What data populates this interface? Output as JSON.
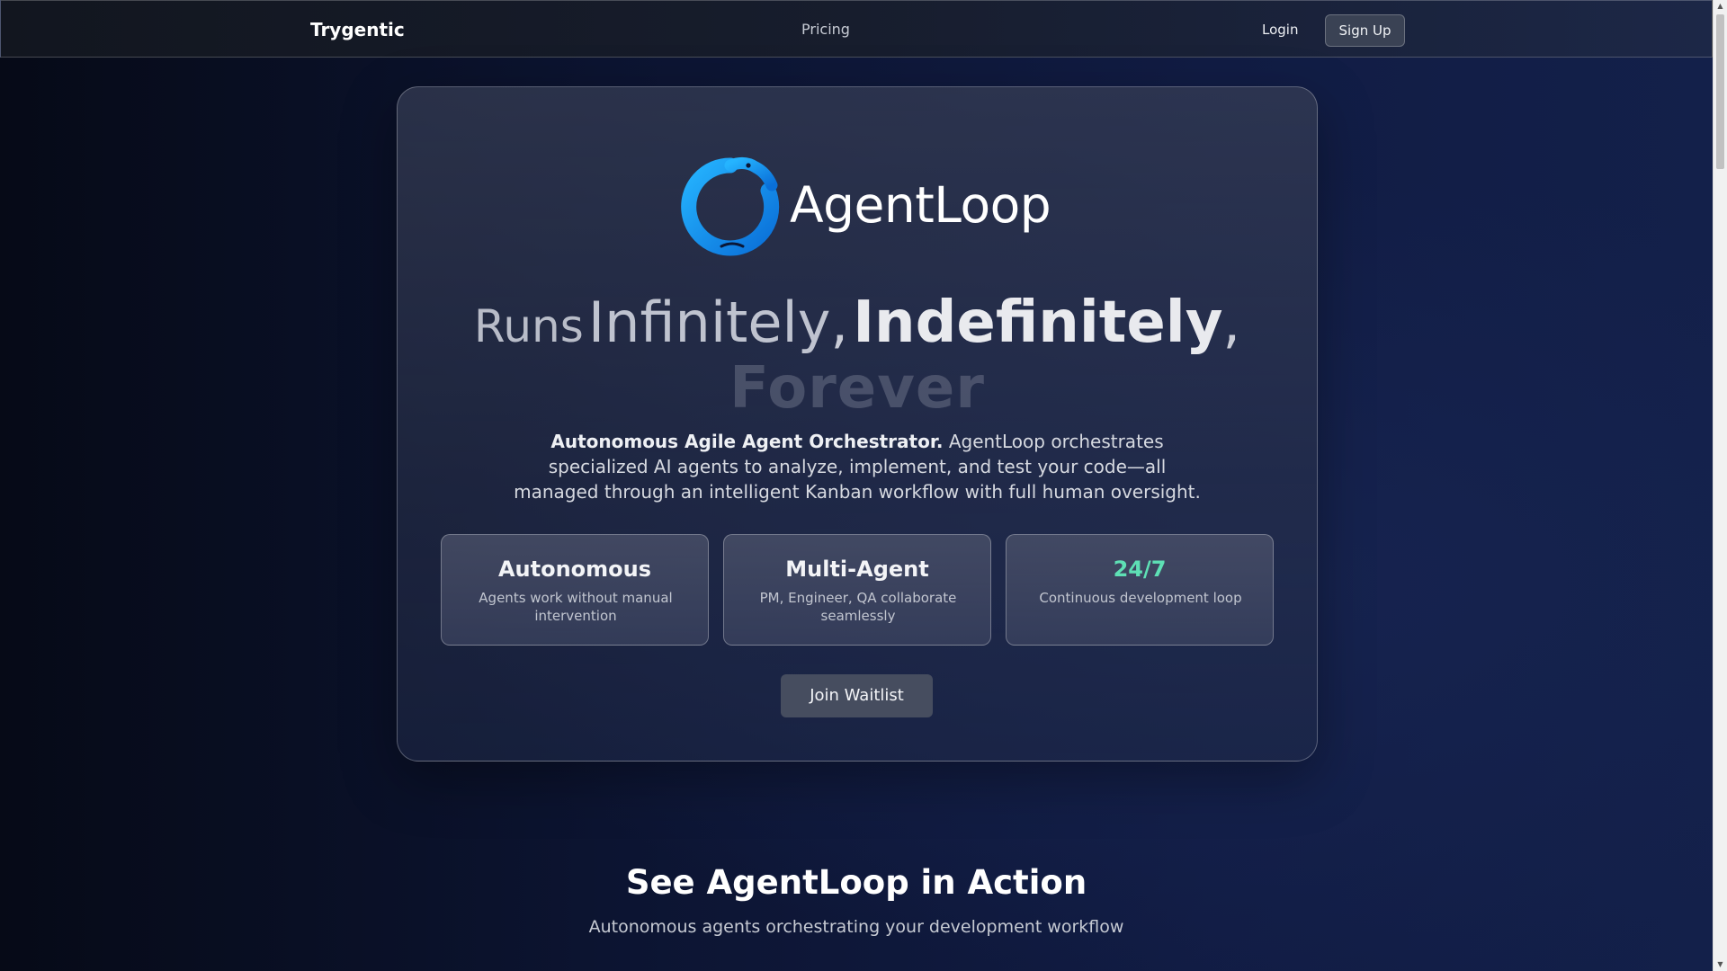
{
  "navbar": {
    "brand": "Trygentic",
    "links": {
      "pricing": "Pricing"
    },
    "login": "Login",
    "signup": "Sign Up"
  },
  "hero": {
    "logo": {
      "icon": "ouroboros-loop-icon",
      "text": "AgentLoop",
      "color": "#1a9ff0"
    },
    "headline": {
      "word1": "Runs",
      "word2": "Infinitely",
      "comma1": ",",
      "word3": "Indefinitely",
      "comma2": ",",
      "word4": "Forever"
    },
    "description": {
      "lead": "Autonomous Agile Agent Orchestrator.",
      "body": "AgentLoop orchestrates specialized AI agents to analyze, implement, and test your code—all managed through an intelligent Kanban workflow with full human oversight."
    },
    "features": [
      {
        "title": "Autonomous",
        "description": "Agents work without manual intervention"
      },
      {
        "title": "Multi-Agent",
        "description": "PM, Engineer, QA collaborate seamlessly"
      },
      {
        "title": "24/7",
        "description": "Continuous development loop",
        "accent": "#5ee0b5"
      }
    ],
    "cta": "Join Waitlist"
  },
  "section": {
    "title": "See AgentLoop in Action",
    "subtitle": "Autonomous agents orchestrating your development workflow"
  }
}
